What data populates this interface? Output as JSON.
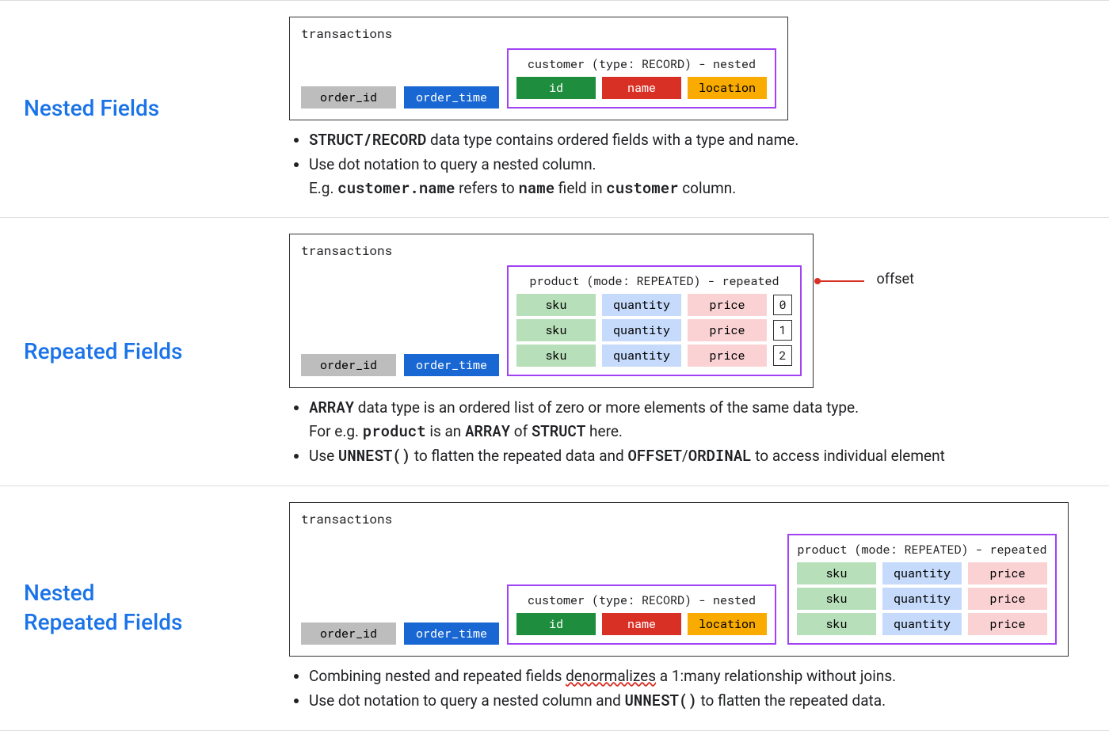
{
  "sections": [
    {
      "title": "Nested Fields",
      "diagram": {
        "table_name": "transactions",
        "main_fields": [
          {
            "label": "order_id",
            "cls": "f-gray"
          },
          {
            "label": "order_time",
            "cls": "f-blue"
          }
        ],
        "nested_groups": [
          {
            "label": "customer (type: RECORD) - nested",
            "rows": [
              [
                {
                  "label": "id",
                  "cls": "f-green"
                },
                {
                  "label": "name",
                  "cls": "f-red"
                },
                {
                  "label": "location",
                  "cls": "f-yellow"
                }
              ]
            ],
            "offsets": false
          }
        ]
      },
      "bullets": [
        {
          "parts": [
            {
              "t": "STRUCT/RECORD",
              "mono": true
            },
            {
              "t": " data type contains ordered fields with a type and name."
            }
          ]
        },
        {
          "parts": [
            {
              "t": "Use dot notation to query a nested column."
            },
            {
              "br": true
            },
            {
              "t": "E.g. "
            },
            {
              "t": "customer.name",
              "mono": true
            },
            {
              "t": " refers to "
            },
            {
              "t": "name",
              "mono": true
            },
            {
              "t": " field in "
            },
            {
              "t": "customer",
              "mono": true
            },
            {
              "t": " column."
            }
          ]
        }
      ]
    },
    {
      "title": "Repeated Fields",
      "diagram": {
        "table_name": "transactions",
        "main_fields": [
          {
            "label": "order_id",
            "cls": "f-gray"
          },
          {
            "label": "order_time",
            "cls": "f-blue"
          }
        ],
        "nested_groups": [
          {
            "label": "product (mode: REPEATED) - repeated",
            "rows": [
              [
                {
                  "label": "sku",
                  "cls": "f-lgreen"
                },
                {
                  "label": "quantity",
                  "cls": "f-lblue"
                },
                {
                  "label": "price",
                  "cls": "f-pink"
                }
              ],
              [
                {
                  "label": "sku",
                  "cls": "f-lgreen"
                },
                {
                  "label": "quantity",
                  "cls": "f-lblue"
                },
                {
                  "label": "price",
                  "cls": "f-pink"
                }
              ],
              [
                {
                  "label": "sku",
                  "cls": "f-lgreen"
                },
                {
                  "label": "quantity",
                  "cls": "f-lblue"
                },
                {
                  "label": "price",
                  "cls": "f-pink"
                }
              ]
            ],
            "offsets": true,
            "offset_values": [
              "0",
              "1",
              "2"
            ]
          }
        ],
        "offset_annotation": "offset"
      },
      "bullets": [
        {
          "parts": [
            {
              "t": "ARRAY",
              "mono": true
            },
            {
              "t": " data type is an ordered list of zero or more elements of the same data type."
            },
            {
              "br": true
            },
            {
              "t": "For e.g. "
            },
            {
              "t": "product",
              "mono": true
            },
            {
              "t": " is an "
            },
            {
              "t": "ARRAY",
              "mono": true
            },
            {
              "t": " of "
            },
            {
              "t": "STRUCT",
              "mono": true
            },
            {
              "t": " here."
            }
          ]
        },
        {
          "parts": [
            {
              "t": "Use "
            },
            {
              "t": "UNNEST()",
              "mono": true
            },
            {
              "t": " to flatten the repeated data and "
            },
            {
              "t": "OFFSET",
              "mono": true
            },
            {
              "t": "/"
            },
            {
              "t": "ORDINAL",
              "mono": true
            },
            {
              "t": " to access individual element"
            }
          ]
        }
      ]
    },
    {
      "title": "Nested\nRepeated Fields",
      "diagram": {
        "table_name": "transactions",
        "main_fields": [
          {
            "label": "order_id",
            "cls": "f-gray"
          },
          {
            "label": "order_time",
            "cls": "f-blue"
          }
        ],
        "nested_groups": [
          {
            "label": "customer (type: RECORD) - nested",
            "rows": [
              [
                {
                  "label": "id",
                  "cls": "f-green"
                },
                {
                  "label": "name",
                  "cls": "f-red"
                },
                {
                  "label": "location",
                  "cls": "f-yellow"
                }
              ]
            ],
            "offsets": false
          },
          {
            "label": "product (mode: REPEATED) - repeated",
            "rows": [
              [
                {
                  "label": "sku",
                  "cls": "f-lgreen"
                },
                {
                  "label": "quantity",
                  "cls": "f-lblue"
                },
                {
                  "label": "price",
                  "cls": "f-pink"
                }
              ],
              [
                {
                  "label": "sku",
                  "cls": "f-lgreen"
                },
                {
                  "label": "quantity",
                  "cls": "f-lblue"
                },
                {
                  "label": "price",
                  "cls": "f-pink"
                }
              ],
              [
                {
                  "label": "sku",
                  "cls": "f-lgreen"
                },
                {
                  "label": "quantity",
                  "cls": "f-lblue"
                },
                {
                  "label": "price",
                  "cls": "f-pink"
                }
              ]
            ],
            "offsets": false
          }
        ]
      },
      "bullets": [
        {
          "parts": [
            {
              "t": "Combining nested and repeated fields "
            },
            {
              "t": "denormalizes",
              "squiggle": true
            },
            {
              "t": " a 1:many relationship without joins."
            }
          ]
        },
        {
          "parts": [
            {
              "t": "Use dot notation to query a nested column and "
            },
            {
              "t": "UNNEST()",
              "mono": true
            },
            {
              "t": " to flatten the repeated data."
            }
          ]
        }
      ]
    }
  ]
}
